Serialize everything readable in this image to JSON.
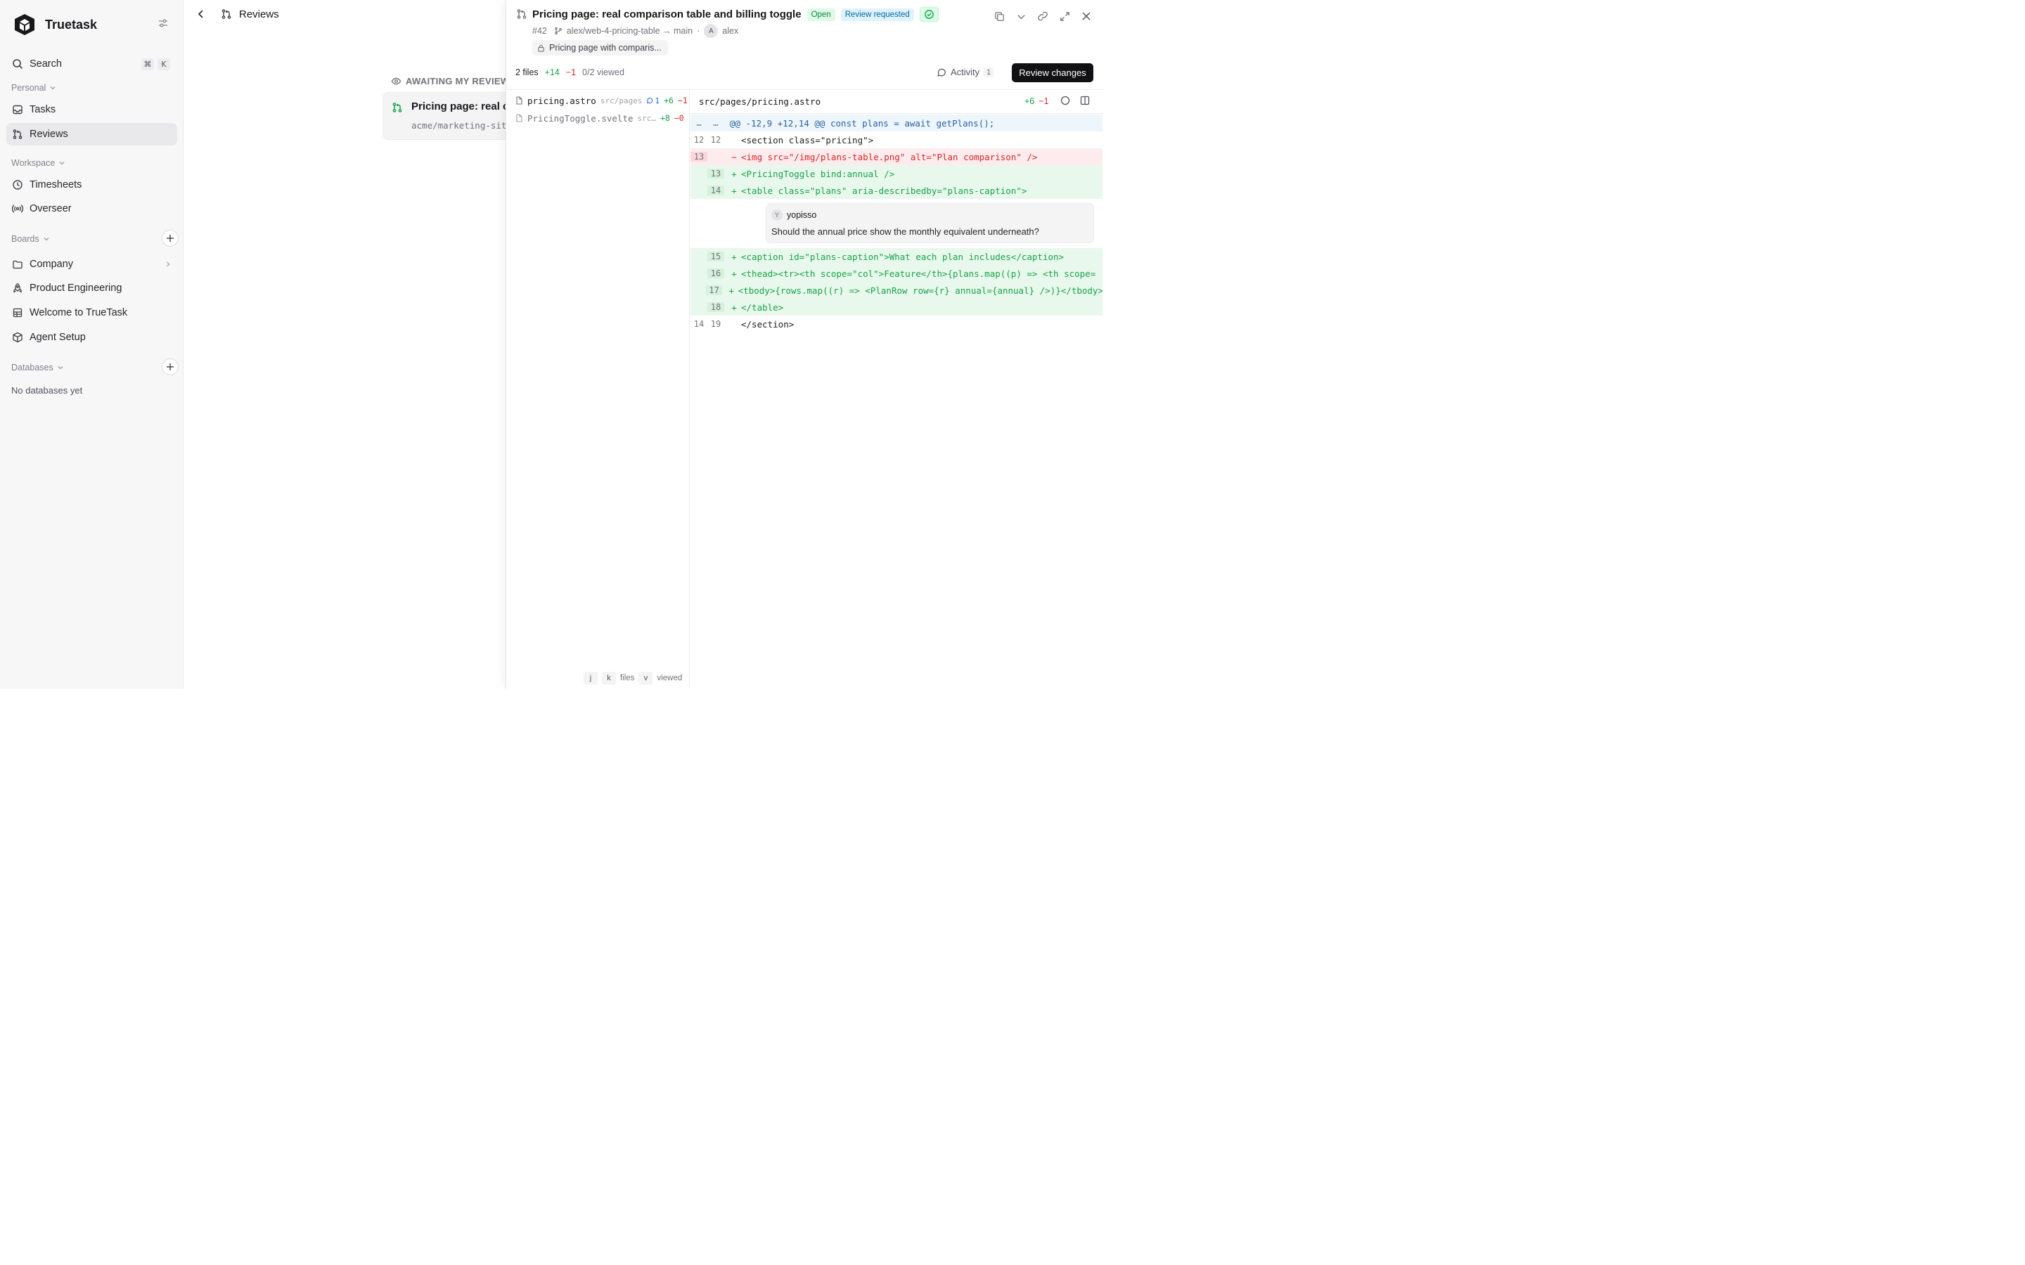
{
  "sidebar": {
    "brand": "Truetask",
    "search_label": "Search",
    "shortcut_keys": [
      "⌘",
      "K"
    ],
    "sections": {
      "personal": "Personal",
      "workspace": "Workspace",
      "boards": "Boards",
      "databases": "Databases"
    },
    "personal_items": [
      {
        "label": "Tasks",
        "icon": "inbox-icon"
      },
      {
        "label": "Reviews",
        "icon": "git-pull-request-icon",
        "active": true
      }
    ],
    "workspace_items": [
      {
        "label": "Timesheets",
        "icon": "clock-icon"
      },
      {
        "label": "Overseer",
        "icon": "broadcast-icon"
      }
    ],
    "board_items": [
      {
        "label": "Company",
        "icon": "folder-icon"
      },
      {
        "label": "Product Engineering",
        "icon": "rocket-icon"
      },
      {
        "label": "Welcome to TrueTask",
        "icon": "grid-icon"
      },
      {
        "label": "Agent Setup",
        "icon": "cube-icon"
      }
    ],
    "databases_empty": "No databases yet"
  },
  "middle": {
    "header_title": "Reviews",
    "section_label": "AWAITING MY REVIEW",
    "card": {
      "title": "Pricing page: real co",
      "subtitle": "acme/marketing-site"
    }
  },
  "panel": {
    "title": "Pricing page: real comparison table and billing toggle",
    "badges": {
      "open": "Open",
      "requested": "Review requested"
    },
    "number": "#42",
    "branch": "alex/web-4-pricing-table → main",
    "separator": "·",
    "author_initial": "A",
    "author": "alex",
    "description": "Pricing page with comparis...",
    "stats": {
      "files": "2 files",
      "added": "+14",
      "removed": "−1",
      "viewed": "0/2 viewed"
    },
    "activity_label": "Activity",
    "activity_count": "1",
    "review_button": "Review changes",
    "files": [
      {
        "name": "pricing.astro",
        "dir": "src/pages",
        "comments": "1",
        "added": "+6",
        "removed": "−1"
      },
      {
        "name": "PricingToggle.svelte",
        "dir": "src…",
        "added": "+8",
        "removed": "−0"
      }
    ],
    "hints": {
      "j": "j",
      "k": "k",
      "files": "files",
      "v": "v",
      "viewed": "viewed"
    },
    "diff": {
      "path": "src/pages/pricing.astro",
      "added": "+6",
      "removed": "−1",
      "hunk": "@@ -12,9 +12,14 @@ const plans = await getPlans();",
      "hunk_old": "…",
      "hunk_new": "…",
      "lines_top": [
        {
          "old": "12",
          "new": "12",
          "sign": " ",
          "type": "ctx",
          "code": "<section class=\"pricing\">"
        },
        {
          "old": "13",
          "new": "",
          "sign": "−",
          "type": "del",
          "code": "<img src=\"/img/plans-table.png\" alt=\"Plan comparison\" />"
        },
        {
          "old": "",
          "new": "13",
          "sign": "+",
          "type": "add",
          "code": "<PricingToggle bind:annual />"
        },
        {
          "old": "",
          "new": "14",
          "sign": "+",
          "type": "add",
          "code": "<table class=\"plans\" aria-describedby=\"plans-caption\">"
        }
      ],
      "comment": {
        "initial": "Y",
        "author": "yopisso",
        "body": "Should the annual price show the monthly equivalent underneath?"
      },
      "lines_bottom": [
        {
          "old": "",
          "new": "15",
          "sign": "+",
          "type": "add",
          "code": "  <caption id=\"plans-caption\">What each plan includes</caption>"
        },
        {
          "old": "",
          "new": "16",
          "sign": "+",
          "type": "add",
          "code": "  <thead><tr><th scope=\"col\">Feature</th>{plans.map((p) => <th scope="
        },
        {
          "old": "",
          "new": "17",
          "sign": "+",
          "type": "add",
          "code": "  <tbody>{rows.map((r) => <PlanRow row={r} annual={annual} />)}</tbody>"
        },
        {
          "old": "",
          "new": "18",
          "sign": "+",
          "type": "add",
          "code": "</table>"
        },
        {
          "old": "14",
          "new": "19",
          "sign": " ",
          "type": "ctx",
          "code": "</section>"
        }
      ]
    }
  },
  "colors": {
    "accent_add": "#16a34a",
    "accent_del": "#dc2626",
    "primary_button": "#111113"
  }
}
